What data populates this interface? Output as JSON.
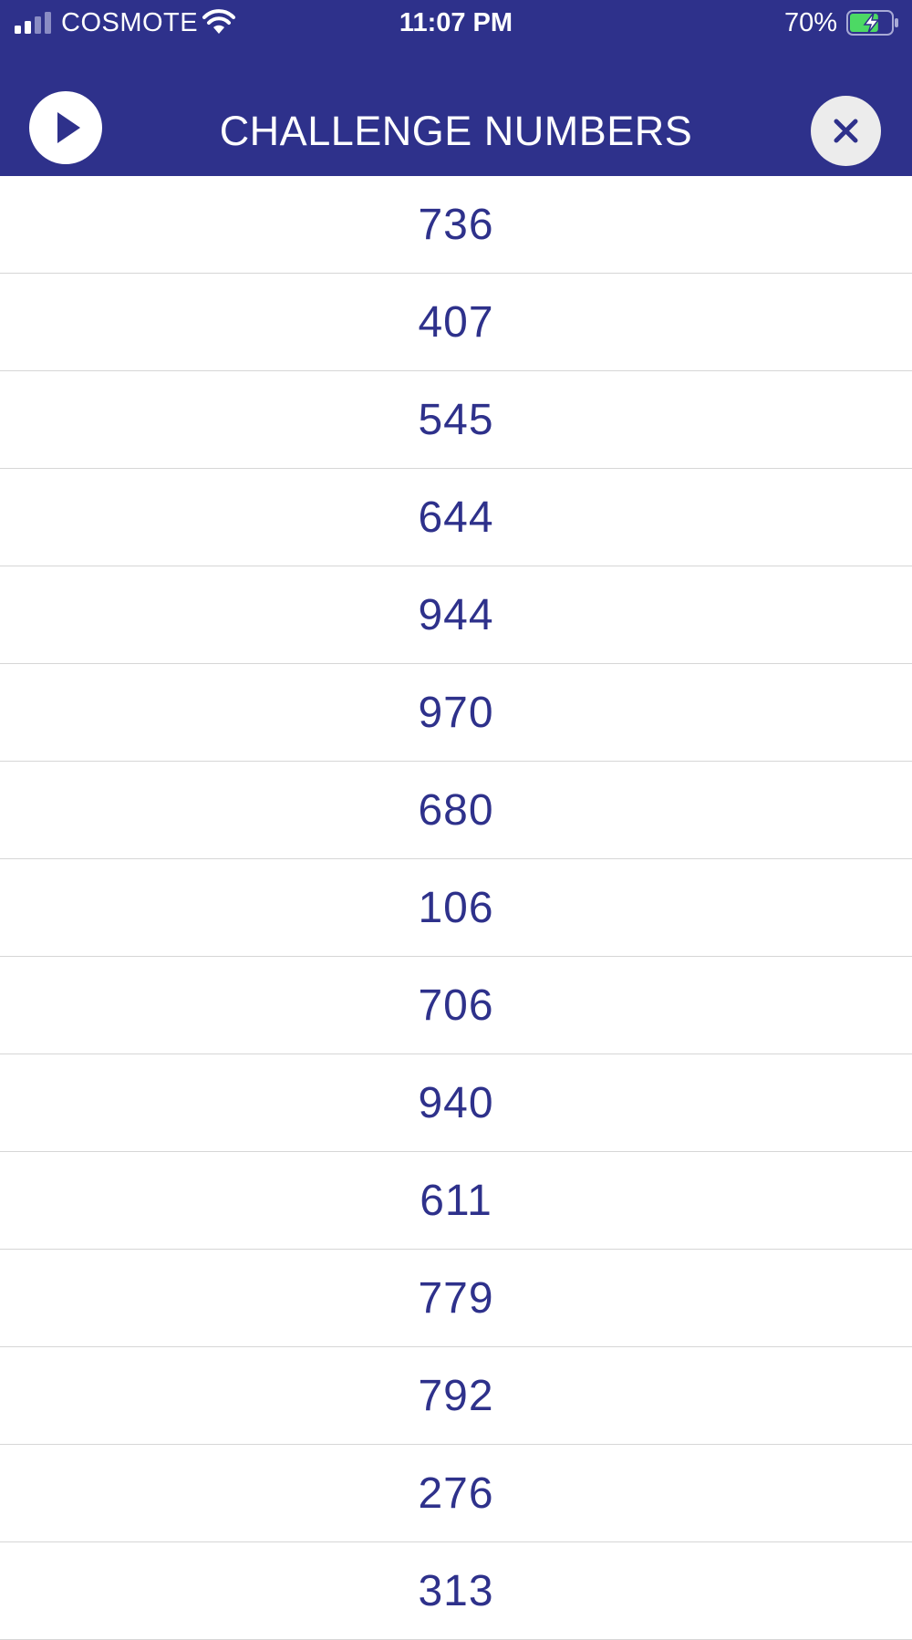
{
  "status_bar": {
    "carrier": "COSMOTE",
    "time": "11:07 PM",
    "battery_percent": "70%",
    "battery_level": 0.7,
    "charging": true
  },
  "header": {
    "title": "CHALLENGE NUMBERS",
    "play_icon": "play-icon",
    "close_icon": "close-icon"
  },
  "colors": {
    "header_background": "#2e318b",
    "number_text": "#2e318b",
    "close_button_background": "#ececec",
    "battery_fill": "#4cd964"
  },
  "numbers": [
    "736",
    "407",
    "545",
    "644",
    "944",
    "970",
    "680",
    "106",
    "706",
    "940",
    "611",
    "779",
    "792",
    "276",
    "313"
  ]
}
